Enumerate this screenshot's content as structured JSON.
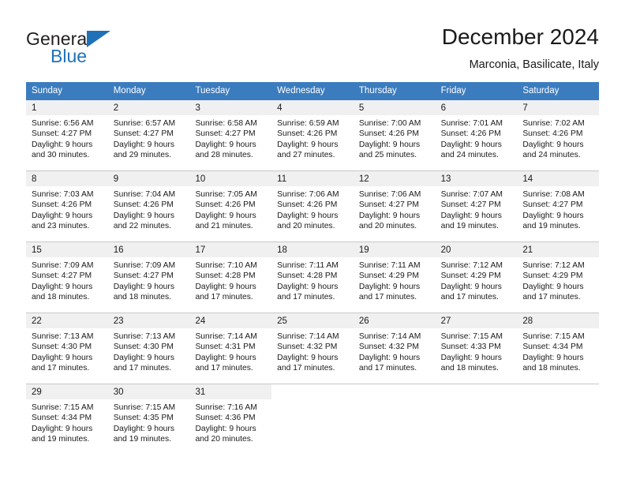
{
  "brand": {
    "name_part1": "General",
    "name_part2": "Blue",
    "flag_icon": "triangle-flag-icon",
    "accent_color": "#1f72b8"
  },
  "header": {
    "title": "December 2024",
    "subtitle": "Marconia, Basilicate, Italy"
  },
  "calendar": {
    "header_bg": "#3b7cbf",
    "daynum_bg": "#f0f0f0",
    "weekdays": [
      "Sunday",
      "Monday",
      "Tuesday",
      "Wednesday",
      "Thursday",
      "Friday",
      "Saturday"
    ],
    "weeks": [
      [
        {
          "day": "1",
          "sunrise": "Sunrise: 6:56 AM",
          "sunset": "Sunset: 4:27 PM",
          "daylight_line1": "Daylight: 9 hours",
          "daylight_line2": "and 30 minutes."
        },
        {
          "day": "2",
          "sunrise": "Sunrise: 6:57 AM",
          "sunset": "Sunset: 4:27 PM",
          "daylight_line1": "Daylight: 9 hours",
          "daylight_line2": "and 29 minutes."
        },
        {
          "day": "3",
          "sunrise": "Sunrise: 6:58 AM",
          "sunset": "Sunset: 4:27 PM",
          "daylight_line1": "Daylight: 9 hours",
          "daylight_line2": "and 28 minutes."
        },
        {
          "day": "4",
          "sunrise": "Sunrise: 6:59 AM",
          "sunset": "Sunset: 4:26 PM",
          "daylight_line1": "Daylight: 9 hours",
          "daylight_line2": "and 27 minutes."
        },
        {
          "day": "5",
          "sunrise": "Sunrise: 7:00 AM",
          "sunset": "Sunset: 4:26 PM",
          "daylight_line1": "Daylight: 9 hours",
          "daylight_line2": "and 25 minutes."
        },
        {
          "day": "6",
          "sunrise": "Sunrise: 7:01 AM",
          "sunset": "Sunset: 4:26 PM",
          "daylight_line1": "Daylight: 9 hours",
          "daylight_line2": "and 24 minutes."
        },
        {
          "day": "7",
          "sunrise": "Sunrise: 7:02 AM",
          "sunset": "Sunset: 4:26 PM",
          "daylight_line1": "Daylight: 9 hours",
          "daylight_line2": "and 24 minutes."
        }
      ],
      [
        {
          "day": "8",
          "sunrise": "Sunrise: 7:03 AM",
          "sunset": "Sunset: 4:26 PM",
          "daylight_line1": "Daylight: 9 hours",
          "daylight_line2": "and 23 minutes."
        },
        {
          "day": "9",
          "sunrise": "Sunrise: 7:04 AM",
          "sunset": "Sunset: 4:26 PM",
          "daylight_line1": "Daylight: 9 hours",
          "daylight_line2": "and 22 minutes."
        },
        {
          "day": "10",
          "sunrise": "Sunrise: 7:05 AM",
          "sunset": "Sunset: 4:26 PM",
          "daylight_line1": "Daylight: 9 hours",
          "daylight_line2": "and 21 minutes."
        },
        {
          "day": "11",
          "sunrise": "Sunrise: 7:06 AM",
          "sunset": "Sunset: 4:26 PM",
          "daylight_line1": "Daylight: 9 hours",
          "daylight_line2": "and 20 minutes."
        },
        {
          "day": "12",
          "sunrise": "Sunrise: 7:06 AM",
          "sunset": "Sunset: 4:27 PM",
          "daylight_line1": "Daylight: 9 hours",
          "daylight_line2": "and 20 minutes."
        },
        {
          "day": "13",
          "sunrise": "Sunrise: 7:07 AM",
          "sunset": "Sunset: 4:27 PM",
          "daylight_line1": "Daylight: 9 hours",
          "daylight_line2": "and 19 minutes."
        },
        {
          "day": "14",
          "sunrise": "Sunrise: 7:08 AM",
          "sunset": "Sunset: 4:27 PM",
          "daylight_line1": "Daylight: 9 hours",
          "daylight_line2": "and 19 minutes."
        }
      ],
      [
        {
          "day": "15",
          "sunrise": "Sunrise: 7:09 AM",
          "sunset": "Sunset: 4:27 PM",
          "daylight_line1": "Daylight: 9 hours",
          "daylight_line2": "and 18 minutes."
        },
        {
          "day": "16",
          "sunrise": "Sunrise: 7:09 AM",
          "sunset": "Sunset: 4:27 PM",
          "daylight_line1": "Daylight: 9 hours",
          "daylight_line2": "and 18 minutes."
        },
        {
          "day": "17",
          "sunrise": "Sunrise: 7:10 AM",
          "sunset": "Sunset: 4:28 PM",
          "daylight_line1": "Daylight: 9 hours",
          "daylight_line2": "and 17 minutes."
        },
        {
          "day": "18",
          "sunrise": "Sunrise: 7:11 AM",
          "sunset": "Sunset: 4:28 PM",
          "daylight_line1": "Daylight: 9 hours",
          "daylight_line2": "and 17 minutes."
        },
        {
          "day": "19",
          "sunrise": "Sunrise: 7:11 AM",
          "sunset": "Sunset: 4:29 PM",
          "daylight_line1": "Daylight: 9 hours",
          "daylight_line2": "and 17 minutes."
        },
        {
          "day": "20",
          "sunrise": "Sunrise: 7:12 AM",
          "sunset": "Sunset: 4:29 PM",
          "daylight_line1": "Daylight: 9 hours",
          "daylight_line2": "and 17 minutes."
        },
        {
          "day": "21",
          "sunrise": "Sunrise: 7:12 AM",
          "sunset": "Sunset: 4:29 PM",
          "daylight_line1": "Daylight: 9 hours",
          "daylight_line2": "and 17 minutes."
        }
      ],
      [
        {
          "day": "22",
          "sunrise": "Sunrise: 7:13 AM",
          "sunset": "Sunset: 4:30 PM",
          "daylight_line1": "Daylight: 9 hours",
          "daylight_line2": "and 17 minutes."
        },
        {
          "day": "23",
          "sunrise": "Sunrise: 7:13 AM",
          "sunset": "Sunset: 4:30 PM",
          "daylight_line1": "Daylight: 9 hours",
          "daylight_line2": "and 17 minutes."
        },
        {
          "day": "24",
          "sunrise": "Sunrise: 7:14 AM",
          "sunset": "Sunset: 4:31 PM",
          "daylight_line1": "Daylight: 9 hours",
          "daylight_line2": "and 17 minutes."
        },
        {
          "day": "25",
          "sunrise": "Sunrise: 7:14 AM",
          "sunset": "Sunset: 4:32 PM",
          "daylight_line1": "Daylight: 9 hours",
          "daylight_line2": "and 17 minutes."
        },
        {
          "day": "26",
          "sunrise": "Sunrise: 7:14 AM",
          "sunset": "Sunset: 4:32 PM",
          "daylight_line1": "Daylight: 9 hours",
          "daylight_line2": "and 17 minutes."
        },
        {
          "day": "27",
          "sunrise": "Sunrise: 7:15 AM",
          "sunset": "Sunset: 4:33 PM",
          "daylight_line1": "Daylight: 9 hours",
          "daylight_line2": "and 18 minutes."
        },
        {
          "day": "28",
          "sunrise": "Sunrise: 7:15 AM",
          "sunset": "Sunset: 4:34 PM",
          "daylight_line1": "Daylight: 9 hours",
          "daylight_line2": "and 18 minutes."
        }
      ],
      [
        {
          "day": "29",
          "sunrise": "Sunrise: 7:15 AM",
          "sunset": "Sunset: 4:34 PM",
          "daylight_line1": "Daylight: 9 hours",
          "daylight_line2": "and 19 minutes."
        },
        {
          "day": "30",
          "sunrise": "Sunrise: 7:15 AM",
          "sunset": "Sunset: 4:35 PM",
          "daylight_line1": "Daylight: 9 hours",
          "daylight_line2": "and 19 minutes."
        },
        {
          "day": "31",
          "sunrise": "Sunrise: 7:16 AM",
          "sunset": "Sunset: 4:36 PM",
          "daylight_line1": "Daylight: 9 hours",
          "daylight_line2": "and 20 minutes."
        },
        {
          "day": "",
          "sunrise": "",
          "sunset": "",
          "daylight_line1": "",
          "daylight_line2": ""
        },
        {
          "day": "",
          "sunrise": "",
          "sunset": "",
          "daylight_line1": "",
          "daylight_line2": ""
        },
        {
          "day": "",
          "sunrise": "",
          "sunset": "",
          "daylight_line1": "",
          "daylight_line2": ""
        },
        {
          "day": "",
          "sunrise": "",
          "sunset": "",
          "daylight_line1": "",
          "daylight_line2": ""
        }
      ]
    ]
  }
}
